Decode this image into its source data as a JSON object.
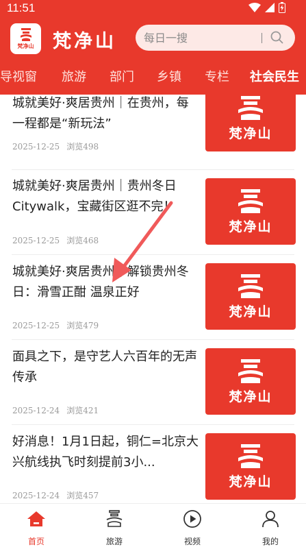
{
  "status_bar": {
    "time": "11:51"
  },
  "header": {
    "app_name": "梵净山",
    "logo_caption": "梵净山",
    "search_placeholder": "每日一搜"
  },
  "tabs": [
    "领导视窗",
    "旅游",
    "部门",
    "乡镇",
    "专栏",
    "社会民生"
  ],
  "active_tab": "社会民生",
  "news": [
    {
      "title": "城就美好·爽居贵州｜在贵州，每一程都是“新玩法”",
      "date": "2025-12-25",
      "views": "浏览498",
      "thumb_text": "梵净山"
    },
    {
      "title": "城就美好·爽居贵州｜贵州冬日Citywalk，宝藏街区逛不完！",
      "date": "2025-12-25",
      "views": "浏览468",
      "thumb_text": "梵净山"
    },
    {
      "title": "城就美好·爽居贵州｜解锁贵州冬日：滑雪正酣 温泉正好",
      "date": "2025-12-25",
      "views": "浏览479",
      "thumb_text": "梵净山"
    },
    {
      "title": "面具之下，是守艺人六百年的无声传承",
      "date": "2025-12-24",
      "views": "浏览421",
      "thumb_text": "梵净山"
    },
    {
      "title": "好消息！1月1日起，铜仁=北京大兴航线执飞时刻提前3小...",
      "date": "2025-12-24",
      "views": "浏览457",
      "thumb_text": "梵净山"
    }
  ],
  "bottom_nav": [
    {
      "label": "首页",
      "icon": "home-icon",
      "active": true
    },
    {
      "label": "旅游",
      "icon": "travel-icon",
      "active": false
    },
    {
      "label": "视频",
      "icon": "play-icon",
      "active": false
    },
    {
      "label": "我的",
      "icon": "user-icon",
      "active": false
    }
  ],
  "colors": {
    "brand_red": "#e8392c",
    "search_bg": "#fde9e6"
  }
}
